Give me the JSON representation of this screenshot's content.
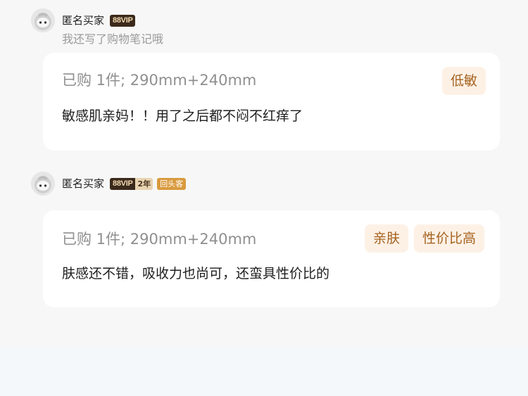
{
  "reviews": [
    {
      "username": "匿名买家",
      "badges": {
        "vip": "88VIP",
        "years": "",
        "returning": ""
      },
      "subtitle": "我还写了购物笔记哦",
      "purchase": "已购 1件; 290mm+240mm",
      "tags": [
        "低敏"
      ],
      "content": "敏感肌亲妈！！用了之后都不闷不红痒了"
    },
    {
      "username": "匿名买家",
      "badges": {
        "vip": "88VIP",
        "years": "2年",
        "returning": "回头客"
      },
      "subtitle": "",
      "purchase": "已购 1件; 290mm+240mm",
      "tags": [
        "亲肤",
        "性价比高"
      ],
      "content": "肤感还不错，吸收力也尚可，还蛮具性价比的"
    }
  ],
  "colors": {
    "tag_bg": "#fdf1e6",
    "tag_text": "#a5621f",
    "vip_bg": "#3b2a1c",
    "returning_bg": "#d99a3d"
  }
}
